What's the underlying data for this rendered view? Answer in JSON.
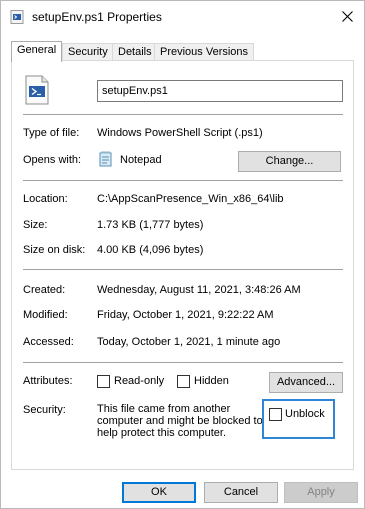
{
  "window": {
    "title": "setupEnv.ps1 Properties"
  },
  "tabs": [
    {
      "label": "General",
      "active": true
    },
    {
      "label": "Security",
      "active": false
    },
    {
      "label": "Details",
      "active": false
    },
    {
      "label": "Previous Versions",
      "active": false
    }
  ],
  "general": {
    "file_name": "setupEnv.ps1",
    "type_label": "Type of file:",
    "type_value": "Windows PowerShell Script (.ps1)",
    "opens_label": "Opens with:",
    "opens_value": "Notepad",
    "change_label": "Change...",
    "location_label": "Location:",
    "location_value": "C:\\AppScanPresence_Win_x86_64\\lib",
    "size_label": "Size:",
    "size_value": "1.73 KB (1,777 bytes)",
    "size_disk_label": "Size on disk:",
    "size_disk_value": "4.00 KB (4,096 bytes)",
    "created_label": "Created:",
    "created_value": "Wednesday, August 11, 2021, 3:48:26 AM",
    "modified_label": "Modified:",
    "modified_value": "Friday, October 1, 2021, 9:22:22 AM",
    "accessed_label": "Accessed:",
    "accessed_value": "Today, October 1, 2021, 1 minute ago",
    "attributes_label": "Attributes:",
    "readonly_label": "Read-only",
    "readonly_checked": false,
    "hidden_label": "Hidden",
    "hidden_checked": false,
    "advanced_label": "Advanced...",
    "security_label": "Security:",
    "security_text": "This file came from another\ncomputer and might be blocked to\nhelp protect this computer.",
    "unblock_label": "Unblock",
    "unblock_checked": false
  },
  "footer": {
    "ok_label": "OK",
    "cancel_label": "Cancel",
    "apply_label": "Apply"
  },
  "colors": {
    "focus_blue": "#0078d7",
    "highlight_blue": "#2f86d6"
  }
}
